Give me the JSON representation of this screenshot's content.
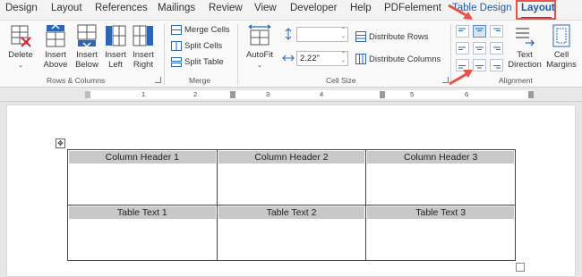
{
  "tabs": [
    {
      "label": "Design"
    },
    {
      "label": "Layout"
    },
    {
      "label": "References"
    },
    {
      "label": "Mailings"
    },
    {
      "label": "Review"
    },
    {
      "label": "View"
    },
    {
      "label": "Developer"
    },
    {
      "label": "Help"
    },
    {
      "label": "PDFelement"
    },
    {
      "label": "Table Design"
    },
    {
      "label": "Layout"
    }
  ],
  "ribbon": {
    "rows_columns": {
      "delete_label": "Delete",
      "insert_above": "Insert\nAbove",
      "insert_above_1": "Insert",
      "insert_above_2": "Above",
      "insert_below_1": "Insert",
      "insert_below_2": "Below",
      "insert_left_1": "Insert",
      "insert_left_2": "Left",
      "insert_right_1": "Insert",
      "insert_right_2": "Right",
      "group_label": "Rows & Columns"
    },
    "merge": {
      "merge_cells": "Merge Cells",
      "split_cells": "Split Cells",
      "split_table": "Split Table",
      "group_label": "Merge"
    },
    "cell_size": {
      "autofit_label": "AutoFit",
      "height_value": "",
      "width_value": "2.22\"",
      "distribute_rows": "Distribute Rows",
      "distribute_columns": "Distribute Columns",
      "group_label": "Cell Size"
    },
    "alignment": {
      "text_direction_1": "Text",
      "text_direction_2": "Direction",
      "cell_margins_1": "Cell",
      "cell_margins_2": "Margins",
      "group_label": "Alignment",
      "selected_option": "Align Top Center"
    }
  },
  "ruler": {
    "numbers": [
      "1",
      "2",
      "3",
      "4",
      "5",
      "6"
    ]
  },
  "document": {
    "table": {
      "headers": [
        "Column Header 1",
        "Column Header 2",
        "Column Header 3"
      ],
      "rows": [
        [
          "Table Text 1",
          "Table Text 2",
          "Table Text 3"
        ]
      ]
    },
    "move_handle_glyph": "✥"
  },
  "colors": {
    "accent": "#1e5aa8",
    "annotation": "#e5534b",
    "cell_shade": "#c8c8c8"
  }
}
